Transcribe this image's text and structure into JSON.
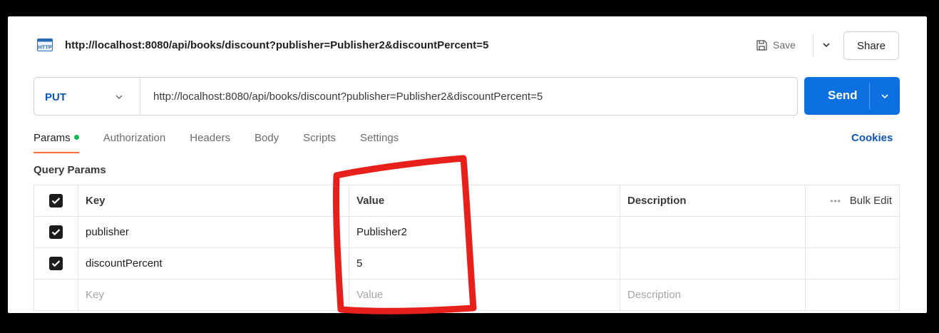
{
  "header": {
    "icon": "http-file-icon",
    "icon_text": "HTTP",
    "title": "http://localhost:8080/api/books/discount?publisher=Publisher2&discountPercent=5",
    "save_label": "Save",
    "share_label": "Share"
  },
  "request": {
    "method": "PUT",
    "url": "http://localhost:8080/api/books/discount?publisher=Publisher2&discountPercent=5",
    "send_label": "Send"
  },
  "tabs": [
    {
      "label": "Params",
      "active": true
    },
    {
      "label": "Authorization"
    },
    {
      "label": "Headers"
    },
    {
      "label": "Body"
    },
    {
      "label": "Scripts"
    },
    {
      "label": "Settings"
    }
  ],
  "cookies_label": "Cookies",
  "query_params": {
    "title": "Query Params",
    "columns": {
      "key": "Key",
      "value": "Value",
      "description": "Description",
      "bulk_edit": "Bulk Edit"
    },
    "rows": [
      {
        "key": "publisher",
        "value": "Publisher2",
        "description": "",
        "checked": true
      },
      {
        "key": "discountPercent",
        "value": "5",
        "description": "",
        "checked": true
      }
    ],
    "placeholders": {
      "key": "Key",
      "value": "Value",
      "description": "Description"
    }
  },
  "colors": {
    "send_button": "#0c70e0",
    "method": "#0b57b4",
    "active_tab_underline": "#ff6c37",
    "params_dot": "#0cbb52",
    "annotation": "#e8201c"
  }
}
